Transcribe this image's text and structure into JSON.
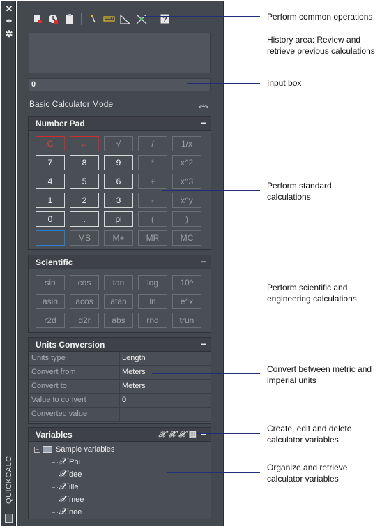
{
  "sidebar": {
    "title": "QUICKCALC",
    "close_icon": "close-icon",
    "autohide_icon": "autohide-icon",
    "properties_icon": "gear-icon"
  },
  "toolbar": {
    "icons": [
      "clear-icon",
      "clear-history-icon",
      "paste-icon",
      "get-coordinates-icon",
      "distance-icon",
      "angle-icon",
      "intersection-icon",
      "help-icon"
    ]
  },
  "input": {
    "value": "0"
  },
  "mode": {
    "label": "Basic Calculator Mode"
  },
  "number_pad": {
    "title": "Number Pad",
    "rows": [
      [
        "C",
        "←",
        "√",
        "/",
        "1/x"
      ],
      [
        "7",
        "8",
        "9",
        "*",
        "x^2"
      ],
      [
        "4",
        "5",
        "6",
        "+",
        "x^3"
      ],
      [
        "1",
        "2",
        "3",
        "-",
        "x^y"
      ],
      [
        "0",
        ".",
        "pi",
        "(",
        ")"
      ],
      [
        "=",
        "MS",
        "M+",
        "MR",
        "MC"
      ]
    ]
  },
  "scientific": {
    "title": "Scientific",
    "rows": [
      [
        "sin",
        "cos",
        "tan",
        "log",
        "10^"
      ],
      [
        "asin",
        "acos",
        "atan",
        "ln",
        "e^x"
      ],
      [
        "r2d",
        "d2r",
        "abs",
        "rnd",
        "trun"
      ]
    ]
  },
  "units": {
    "title": "Units Conversion",
    "rows": [
      {
        "label": "Units type",
        "value": "Length"
      },
      {
        "label": "Convert from",
        "value": "Meters"
      },
      {
        "label": "Convert to",
        "value": "Meters"
      },
      {
        "label": "Value to convert",
        "value": "0"
      },
      {
        "label": "Converted value",
        "value": ""
      }
    ]
  },
  "variables": {
    "title": "Variables",
    "group": "Sample variables",
    "items": [
      "Phi",
      "dee",
      "ille",
      "mee",
      "nee"
    ]
  },
  "callouts": {
    "common_ops": "Perform common operations",
    "history": "History area: Review and retrieve previous calculations",
    "input_box": "Input box",
    "standard": "Perform standard calculations",
    "scientific": "Perform scientific and engineering calculations",
    "units": "Convert between metric and imperial units",
    "var_edit": "Create, edit and delete calculator variables",
    "var_organize": "Organize and retrieve calculator variables"
  }
}
